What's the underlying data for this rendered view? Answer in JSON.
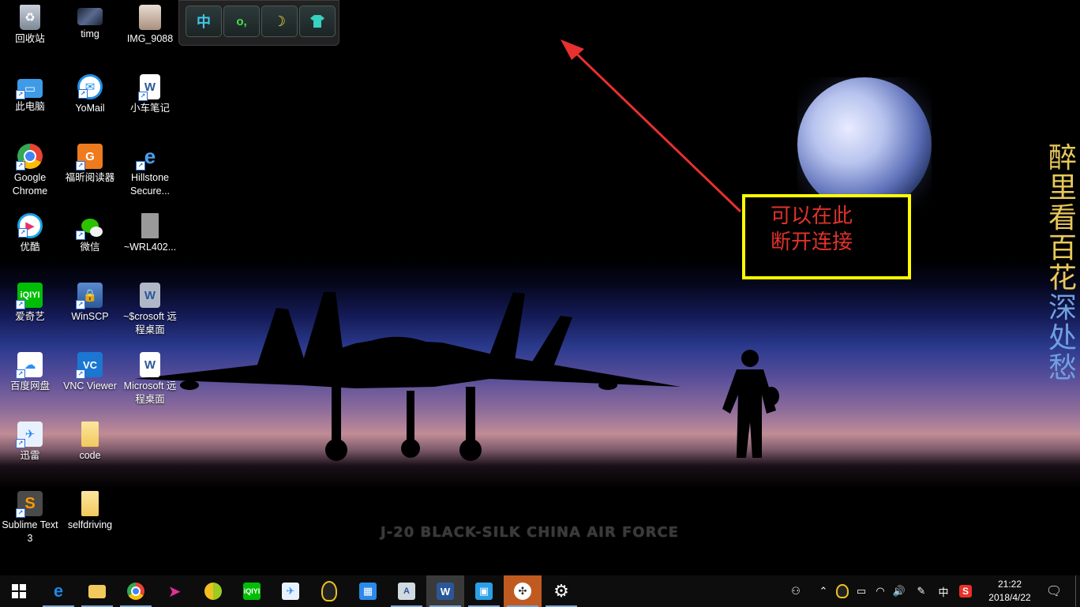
{
  "desktop_icons": [
    {
      "label": "回收站",
      "icon": "recycle-bin-icon",
      "color": "#9aa4b0"
    },
    {
      "label": "timg",
      "icon": "image-file-icon",
      "color": "#3a4a6a"
    },
    {
      "label": "IMG_9088",
      "icon": "photo-file-icon",
      "color": "#c9b8a8"
    },
    {
      "label": "此电脑",
      "icon": "computer-icon",
      "color": "#3e9be8"
    },
    {
      "label": "YoMail",
      "icon": "yomail-icon",
      "color": "#1f8ee8"
    },
    {
      "label": "小车笔记",
      "icon": "word-document-icon",
      "color": "#2b5797"
    },
    {
      "label": "Google Chrome",
      "icon": "chrome-icon",
      "color": "#e84335"
    },
    {
      "label": "福昕阅读器",
      "icon": "foxit-reader-icon",
      "color": "#f07a1e"
    },
    {
      "label": "Hillstone Secure...",
      "icon": "hillstone-vpn-icon",
      "color": "#1d6fb8"
    },
    {
      "label": "优酷",
      "icon": "youku-icon",
      "color": "#1aa1e8"
    },
    {
      "label": "微信",
      "icon": "wechat-icon",
      "color": "#2dc100"
    },
    {
      "label": "~WRL402...",
      "icon": "blank-file-icon",
      "color": "#9a9a9a"
    },
    {
      "label": "爱奇艺",
      "icon": "iqiyi-icon",
      "color": "#00be06"
    },
    {
      "label": "WinSCP",
      "icon": "winscp-icon",
      "color": "#3a6fb0"
    },
    {
      "label": "~$crosoft 远程桌面",
      "icon": "word-temp-file-icon",
      "color": "#2b5797"
    },
    {
      "label": "百度网盘",
      "icon": "baidu-netdisk-icon",
      "color": "#2a8ff7"
    },
    {
      "label": "VNC Viewer",
      "icon": "vnc-viewer-icon",
      "color": "#1b77d2"
    },
    {
      "label": "Microsoft 远程桌面",
      "icon": "word-document-icon",
      "color": "#2b5797"
    },
    {
      "label": "迅雷",
      "icon": "xunlei-icon",
      "color": "#2f8cf0"
    },
    {
      "label": "code",
      "icon": "folder-icon",
      "color": "#f2c95c"
    },
    {
      "label": "Sublime Text 3",
      "icon": "sublime-text-icon",
      "color": "#ff9800"
    },
    {
      "label": "selfdriving",
      "icon": "folder-icon",
      "color": "#f2c95c"
    }
  ],
  "ime_toolbar": {
    "buttons": [
      {
        "label": "中",
        "icon": "chinese-mode-icon",
        "color": "#3ec8e8"
      },
      {
        "label": "o,",
        "icon": "punctuation-icon",
        "color": "#4be04b"
      },
      {
        "label": "☽",
        "icon": "half-width-moon-icon",
        "color": "#f0e040"
      },
      {
        "label": "👕",
        "icon": "skin-icon",
        "color": "#38d0c0"
      }
    ]
  },
  "annotation": {
    "line1": "可以在此",
    "line2": "断开连接",
    "border_color": "#ffff00",
    "text_color": "#e0322a"
  },
  "wallpaper": {
    "caption": "J-20 BLACK-SILK    CHINA AIR FORCE",
    "poem_chars": [
      "醉",
      "里",
      "看",
      "百",
      "花",
      "深",
      "处",
      "愁"
    ],
    "poem_colors": [
      "#e8c85a",
      "#e8c85a",
      "#e8c85a",
      "#e8c85a",
      "#e8c85a",
      "#6fa0e0",
      "#6fa0e0",
      "#6fa0e0"
    ]
  },
  "taskbar": {
    "apps": [
      {
        "icon": "windows-start-icon",
        "color": "#ffffff"
      },
      {
        "icon": "edge-icon",
        "color": "#1e88e5"
      },
      {
        "icon": "file-explorer-icon",
        "color": "#f2c95c"
      },
      {
        "icon": "chrome-icon",
        "color": "#e84335"
      },
      {
        "icon": "paper-plane-icon",
        "color": "#e0309a"
      },
      {
        "icon": "ball-icon",
        "color": "#9ccc20"
      },
      {
        "icon": "iqiyi-icon",
        "color": "#00be06"
      },
      {
        "icon": "xunlei-icon",
        "color": "#2f8cf0"
      },
      {
        "icon": "qq-icon",
        "color": "#f0c020"
      },
      {
        "icon": "store-grid-icon",
        "color": "#2b8ae8"
      },
      {
        "icon": "document-icon",
        "color": "#d0d8e0"
      },
      {
        "icon": "word-icon",
        "color": "#2b5797"
      },
      {
        "icon": "remote-desktop-icon",
        "color": "#2aa0e8"
      },
      {
        "icon": "drone-app-icon",
        "color": "#c05a20"
      },
      {
        "icon": "settings-gear-icon",
        "color": "#ffffff"
      }
    ],
    "tray": {
      "ime_indicator": "中",
      "time": "21:22",
      "date": "2018/4/22"
    }
  }
}
